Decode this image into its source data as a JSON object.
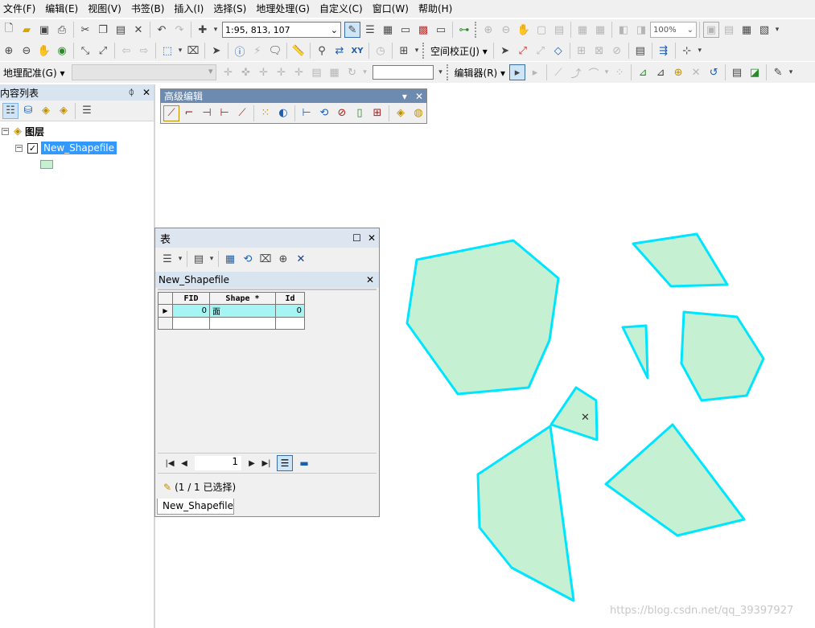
{
  "menubar": {
    "items": [
      "文件(F)",
      "编辑(E)",
      "视图(V)",
      "书签(B)",
      "插入(I)",
      "选择(S)",
      "地理处理(G)",
      "自定义(C)",
      "窗口(W)",
      "帮助(H)"
    ]
  },
  "toolbar1": {
    "scale": "1:95, 813, 107",
    "zoom": "100%"
  },
  "toolbar2": {
    "spatial_adjust_label": "空间校正(J) ▾"
  },
  "toolbar3": {
    "georef_label": "地理配准(G) ▾",
    "editor_label": "编辑器(R) ▾"
  },
  "toc": {
    "title": "内容列表",
    "pin": "ᛰ",
    "close": "✕",
    "group_label": "图层",
    "layer_name": "New_Shapefile",
    "layer_checked": "✓",
    "fill_color": "#c6f0d2"
  },
  "advanced_editing": {
    "title": "高级编辑",
    "menu_arrow": "▾",
    "close": "✕"
  },
  "table_window": {
    "title": "表",
    "maximize": "☐",
    "close": "✕",
    "layer_tab_title": "New_Shapefile",
    "layer_close": "✕",
    "columns": [
      "FID",
      "Shape *",
      "Id"
    ],
    "rows": [
      {
        "marker": "▶",
        "FID": "0",
        "Shape": "面",
        "Id": "0"
      }
    ],
    "nav": {
      "first": "|◀",
      "prev": "◀",
      "page": "1",
      "next": "▶",
      "last": "▶|"
    },
    "status": "(1 / 1 已选择)",
    "bottom_tab": "New_Shapefile"
  },
  "map": {
    "polygon_fill": "#c6f0d2",
    "polygon_stroke": "#00e5ff",
    "cursor_mark": "✕"
  },
  "watermark": "https://blog.csdn.net/qq_39397927"
}
